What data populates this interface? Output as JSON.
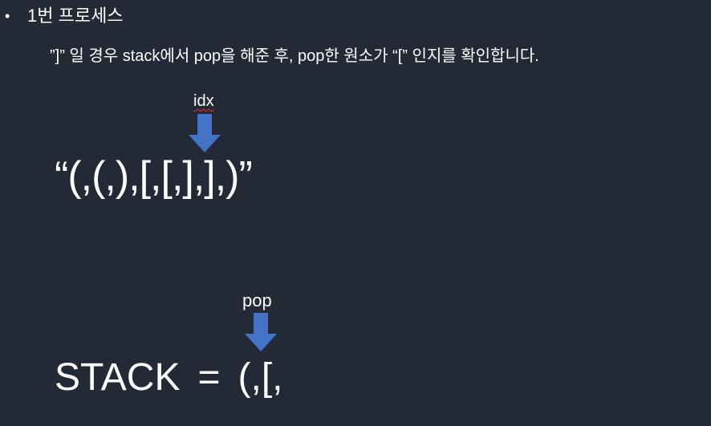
{
  "slide": {
    "bullet": "•",
    "heading": "1번 프로세스",
    "description": "”]” 일 경우 stack에서 pop을 해준 후, pop한 원소가 “[” 인지를 확인합니다.",
    "idx_label": "idx",
    "expression": "“(,(,),[,[,],],)”",
    "pop_label": "pop",
    "stack_label": "STACK",
    "stack_equals": "=",
    "stack_contents": "(,[,"
  },
  "colors": {
    "background": "#232a35",
    "text": "#ffffff",
    "arrow": "#4472c4",
    "spellcheck_underline": "#dd3333"
  },
  "icons": {
    "idx_arrow": "down-arrow-icon",
    "pop_arrow": "down-arrow-icon"
  }
}
